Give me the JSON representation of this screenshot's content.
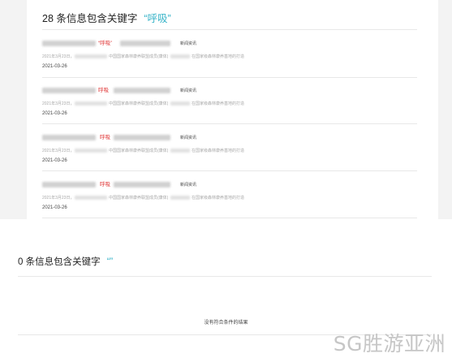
{
  "section1": {
    "count_text": "28 条信息包含关键字",
    "keyword": "“呼吸”"
  },
  "results": [
    {
      "title_highlight": "“呼吸”",
      "category": "新闻资讯",
      "snippet_start": "2021年3月23日，",
      "snippet_mid": "中国国家森林康养联盟成员(康体)",
      "snippet_end": "在国家级森林康养基地的打造",
      "date": "2021-03-26"
    },
    {
      "title_highlight": "呼吸",
      "category": "新闻资讯",
      "snippet_start": "2021年3月23日，",
      "snippet_mid": "中国国家森林康养联盟成员(康体)",
      "snippet_end": "在国家级森林康养基地的打造",
      "date": "2021-03-26"
    },
    {
      "title_highlight": "呼吸",
      "category": "新闻资讯",
      "snippet_start": "2021年3月23日，",
      "snippet_mid": "中国国家森林康养联盟成员(康体)",
      "snippet_end": "在国家级森林康养基地的打造",
      "date": "2021-03-26"
    },
    {
      "title_highlight": "呼吸",
      "category": "新闻资讯",
      "snippet_start": "2021年3月23日，",
      "snippet_mid": "中国国家森林康养联盟成员(康体)",
      "snippet_end": "在国家级森林康养基地的打造",
      "date": "2021-03-26"
    }
  ],
  "section2": {
    "count_text": "0 条信息包含关键字",
    "keyword": "“”"
  },
  "empty_message": "没有符合条件的结果",
  "watermark": "SG胜游亚洲",
  "colors": {
    "keyword": "#36b3c8",
    "highlight": "#e03a3a"
  }
}
